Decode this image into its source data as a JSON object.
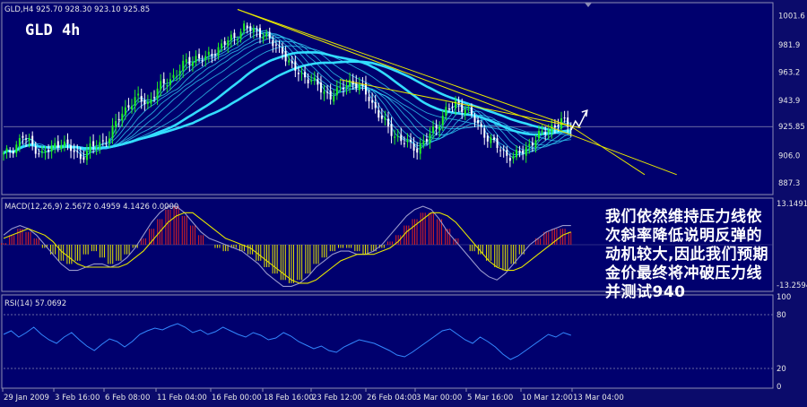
{
  "header": {
    "symbol_line": "GLD,H4  925.70 928.30 923.10 925.85",
    "big_title": "GLD 4h"
  },
  "annotation": {
    "lines": [
      "我们依然维持压力线依",
      "次斜率降低说明反弹的",
      "动机较大,因此我们预期",
      "金价最终将冲破压力线",
      "并测试940"
    ]
  },
  "colors": {
    "background": "#0b0b6b",
    "panel": "#00006e",
    "bull_candle": "#22ee22",
    "ma": "#33ddff",
    "trendline": "#e6e600",
    "macd_pos": "#dd2222",
    "macd_neg": "#e6e600",
    "rsi": "#3388ff"
  },
  "chart_data": [
    {
      "type": "candlestick",
      "title": "GLD,H4",
      "last_quote": {
        "open": 925.7,
        "high": 928.3,
        "low": 923.1,
        "close": 925.85
      },
      "y_ticks": [
        1001.6,
        981.9,
        963.2,
        943.9,
        925.85,
        906.0,
        887.3
      ],
      "ylim": [
        880,
        1010
      ],
      "x_ticks": [
        "29 Jan 2009",
        "3 Feb 16:00",
        "6 Feb 08:00",
        "11 Feb 04:00",
        "16 Feb 00:00",
        "18 Feb 16:00",
        "23 Feb 12:00",
        "26 Feb 04:00",
        "3 Mar 00:00",
        "5 Mar 16:00",
        "10 Mar 12:00",
        "13 Mar 04:00"
      ],
      "close_path": [
        [
          0,
          906
        ],
        [
          3,
          911
        ],
        [
          6,
          919
        ],
        [
          9,
          913
        ],
        [
          12,
          907
        ],
        [
          15,
          911
        ],
        [
          18,
          916
        ],
        [
          21,
          910
        ],
        [
          24,
          905
        ],
        [
          27,
          911
        ],
        [
          30,
          914
        ],
        [
          33,
          919
        ],
        [
          36,
          932
        ],
        [
          39,
          941
        ],
        [
          42,
          945
        ],
        [
          45,
          942
        ],
        [
          48,
          951
        ],
        [
          51,
          957
        ],
        [
          54,
          962
        ],
        [
          57,
          970
        ],
        [
          60,
          973
        ],
        [
          63,
          972
        ],
        [
          66,
          978
        ],
        [
          69,
          983
        ],
        [
          72,
          987
        ],
        [
          75,
          994
        ],
        [
          78,
          991
        ],
        [
          81,
          990
        ],
        [
          84,
          982
        ],
        [
          87,
          978
        ],
        [
          90,
          966
        ],
        [
          93,
          961
        ],
        [
          96,
          958
        ],
        [
          99,
          951
        ],
        [
          102,
          947
        ],
        [
          105,
          951
        ],
        [
          108,
          957
        ],
        [
          111,
          953
        ],
        [
          114,
          946
        ],
        [
          117,
          934
        ],
        [
          120,
          925
        ],
        [
          123,
          918
        ],
        [
          126,
          914
        ],
        [
          129,
          911
        ],
        [
          132,
          917
        ],
        [
          135,
          926
        ],
        [
          138,
          937
        ],
        [
          141,
          941
        ],
        [
          144,
          939
        ],
        [
          147,
          930
        ],
        [
          150,
          921
        ],
        [
          153,
          914
        ],
        [
          156,
          908
        ],
        [
          159,
          905
        ],
        [
          162,
          909
        ],
        [
          165,
          916
        ],
        [
          168,
          921
        ],
        [
          171,
          926
        ],
        [
          174,
          929
        ],
        [
          177,
          926
        ]
      ],
      "moving_averages_visible": 10,
      "trendlines": [
        {
          "from": [
            73,
            1006
          ],
          "to": [
            210,
            893
          ]
        },
        {
          "from": [
            73,
            1006
          ],
          "to": [
            177,
            926
          ]
        },
        {
          "from": [
            177,
            926
          ],
          "to": [
            200,
            893
          ]
        },
        {
          "from": [
            105,
            958
          ],
          "to": [
            180,
            925
          ]
        }
      ],
      "horizontal_line": 925.85,
      "forecast_arrow": "up"
    },
    {
      "type": "bar",
      "title": "MACD(12,26,9) 2.5672 0.4959 4.1426 0.0000",
      "y_ticks": [
        13.1491,
        -13.2594
      ],
      "ylim": [
        -14,
        14
      ],
      "histogram": [
        0.5,
        3,
        5,
        4,
        2,
        -1,
        -3,
        -5,
        -6,
        -5,
        -3,
        -2,
        -4,
        -6,
        -5,
        -3,
        -1,
        2,
        5,
        8,
        11,
        12,
        9,
        6,
        3,
        0,
        -1,
        -2,
        -1,
        -2,
        -3,
        -5,
        -7,
        -9,
        -11,
        -12,
        -11,
        -9,
        -6,
        -4,
        -2,
        -1,
        -1,
        -2,
        -3,
        -2,
        -1,
        1,
        3,
        6,
        8,
        10,
        10,
        8,
        5,
        2,
        0,
        -2,
        -3,
        -5,
        -7,
        -8,
        -6,
        -3,
        0,
        2,
        4,
        5,
        5,
        4
      ],
      "series": [
        {
          "name": "MACD",
          "values": [
            3,
            5,
            6,
            5,
            3,
            0,
            -3,
            -6,
            -8,
            -8,
            -7,
            -6,
            -6,
            -7,
            -6,
            -4,
            -1,
            3,
            7,
            10,
            12,
            12,
            10,
            7,
            4,
            2,
            1,
            0,
            -1,
            -2,
            -4,
            -6,
            -9,
            -11,
            -13,
            -13,
            -12,
            -10,
            -7,
            -5,
            -3,
            -2,
            -2,
            -3,
            -3,
            -2,
            0,
            3,
            6,
            9,
            11,
            12,
            11,
            8,
            4,
            1,
            -2,
            -5,
            -8,
            -10,
            -11,
            -9,
            -6,
            -3,
            0,
            2,
            4,
            5,
            6,
            6
          ]
        },
        {
          "name": "Signal",
          "values": [
            2,
            3,
            4,
            5,
            4,
            3,
            1,
            -2,
            -4,
            -6,
            -7,
            -7,
            -7,
            -7,
            -7,
            -6,
            -4,
            -2,
            1,
            4,
            7,
            9,
            10,
            10,
            8,
            6,
            4,
            2,
            1,
            0,
            -1,
            -3,
            -5,
            -7,
            -9,
            -11,
            -12,
            -12,
            -11,
            -9,
            -7,
            -5,
            -4,
            -3,
            -3,
            -3,
            -2,
            -1,
            1,
            4,
            6,
            8,
            10,
            10,
            9,
            7,
            4,
            1,
            -2,
            -5,
            -7,
            -8,
            -8,
            -7,
            -5,
            -3,
            -1,
            1,
            3,
            4
          ]
        }
      ]
    },
    {
      "type": "line",
      "title": "RSI(14) 57.0692",
      "y_ticks": [
        100,
        80,
        20,
        0
      ],
      "ylim": [
        0,
        100
      ],
      "levels": [
        80,
        20
      ],
      "series": [
        {
          "name": "RSI",
          "values": [
            58,
            62,
            55,
            60,
            66,
            58,
            52,
            48,
            55,
            60,
            52,
            45,
            40,
            47,
            53,
            50,
            44,
            50,
            58,
            62,
            65,
            63,
            67,
            70,
            66,
            60,
            63,
            58,
            61,
            66,
            62,
            58,
            55,
            60,
            57,
            52,
            54,
            60,
            56,
            50,
            46,
            42,
            45,
            40,
            38,
            44,
            48,
            52,
            50,
            48,
            44,
            40,
            35,
            33,
            38,
            44,
            50,
            56,
            62,
            64,
            58,
            52,
            48,
            55,
            50,
            44,
            36,
            30,
            34,
            40,
            46,
            52,
            58,
            55,
            60,
            57
          ]
        }
      ]
    }
  ]
}
